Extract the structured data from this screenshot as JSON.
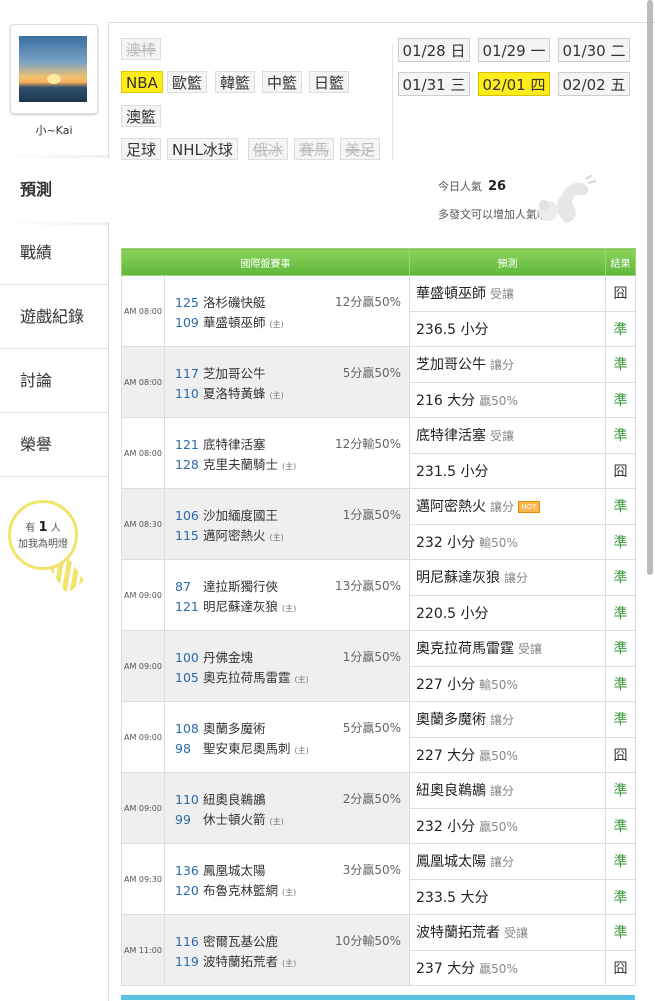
{
  "user": {
    "name": "小~Kai"
  },
  "nav": [
    {
      "label": "預測",
      "active": true
    },
    {
      "label": "戰績"
    },
    {
      "label": "遊戲紀錄"
    },
    {
      "label": "討論"
    },
    {
      "label": "榮譽"
    }
  ],
  "fans": {
    "prefix": "有",
    "count": "1",
    "suffix": "人",
    "line2": "加我為明燈"
  },
  "leagues": {
    "row1": [
      {
        "label": "澳棒",
        "disabled": true
      }
    ],
    "row2": [
      {
        "label": "NBA",
        "active": true
      },
      {
        "label": "歐籃"
      },
      {
        "label": "韓籃"
      },
      {
        "label": "中籃"
      },
      {
        "label": "日籃"
      }
    ],
    "row3": [
      {
        "label": "澳籃"
      }
    ],
    "row4": [
      {
        "label": "足球"
      },
      {
        "label": "NHL冰球"
      },
      {
        "label": "俄冰",
        "disabled": true
      },
      {
        "label": "賽馬",
        "disabled": true
      },
      {
        "label": "美足",
        "disabled": true
      }
    ]
  },
  "dates": [
    {
      "md": "01/28",
      "wd": "日"
    },
    {
      "md": "01/29",
      "wd": "一"
    },
    {
      "md": "01/30",
      "wd": "二"
    },
    {
      "md": "01/31",
      "wd": "三"
    },
    {
      "md": "02/01",
      "wd": "四",
      "active": true
    },
    {
      "md": "02/02",
      "wd": "五"
    }
  ],
  "popularity": {
    "label": "今日人氣",
    "value": "26",
    "hint": "多發文可以增加人氣哦~"
  },
  "table": {
    "headers": [
      "國際盤賽事",
      "預測",
      "結果"
    ],
    "home_mark": "(主)",
    "games": [
      {
        "time": "AM 08:00",
        "away_score": "125",
        "away": "洛杉磯快艇",
        "home_score": "109",
        "home": "華盛頓巫師",
        "spread": "12分贏50%",
        "pick1": "華盛頓巫師",
        "pick1_sub": "受讓",
        "pick2": "236.5 小分",
        "pick2_sub": "",
        "r1": "囧",
        "r2": "準"
      },
      {
        "time": "AM 08:00",
        "away_score": "117",
        "away": "芝加哥公牛",
        "home_score": "110",
        "home": "夏洛特黃蜂",
        "spread": "5分贏50%",
        "pick1": "芝加哥公牛",
        "pick1_sub": "讓分",
        "pick2": "216 大分",
        "pick2_sub": "贏50%",
        "r1": "準",
        "r2": "準"
      },
      {
        "time": "AM 08:00",
        "away_score": "121",
        "away": "底特律活塞",
        "home_score": "128",
        "home": "克里夫蘭騎士",
        "spread": "12分輸50%",
        "pick1": "底特律活塞",
        "pick1_sub": "受讓",
        "pick2": "231.5 小分",
        "pick2_sub": "",
        "r1": "準",
        "r2": "囧"
      },
      {
        "time": "AM 08:30",
        "away_score": "106",
        "away": "沙加緬度國王",
        "home_score": "115",
        "home": "邁阿密熱火",
        "spread": "1分贏50%",
        "pick1": "邁阿密熱火",
        "pick1_sub": "讓分",
        "hot": "HOT",
        "pick2": "232 小分",
        "pick2_sub": "輸50%",
        "r1": "準",
        "r2": "準"
      },
      {
        "time": "AM 09:00",
        "away_score": "87",
        "away": "達拉斯獨行俠",
        "home_score": "121",
        "home": "明尼蘇達灰狼",
        "spread": "13分贏50%",
        "pick1": "明尼蘇達灰狼",
        "pick1_sub": "讓分",
        "pick2": "220.5 小分",
        "pick2_sub": "",
        "r1": "準",
        "r2": "準"
      },
      {
        "time": "AM 09:00",
        "away_score": "100",
        "away": "丹佛金塊",
        "home_score": "105",
        "home": "奧克拉荷馬雷霆",
        "spread": "1分贏50%",
        "pick1": "奧克拉荷馬雷霆",
        "pick1_sub": "受讓",
        "pick2": "227 小分",
        "pick2_sub": "輸50%",
        "r1": "準",
        "r2": "準"
      },
      {
        "time": "AM 09:00",
        "away_score": "108",
        "away": "奧蘭多魔術",
        "home_score": "98",
        "home": "聖安東尼奧馬刺",
        "spread": "5分贏50%",
        "pick1": "奧蘭多魔術",
        "pick1_sub": "讓分",
        "pick2": "227 大分",
        "pick2_sub": "贏50%",
        "r1": "準",
        "r2": "囧"
      },
      {
        "time": "AM 09:00",
        "away_score": "110",
        "away": "紐奧良鵜鶘",
        "home_score": "99",
        "home": "休士頓火箭",
        "spread": "2分贏50%",
        "pick1": "紐奧良鵜鶘",
        "pick1_sub": "讓分",
        "pick2": "232 小分",
        "pick2_sub": "贏50%",
        "r1": "準",
        "r2": "準"
      },
      {
        "time": "AM 09:30",
        "away_score": "136",
        "away": "鳳凰城太陽",
        "home_score": "120",
        "home": "布魯克林籃網",
        "spread": "3分贏50%",
        "pick1": "鳳凰城太陽",
        "pick1_sub": "讓分",
        "pick2": "233.5 大分",
        "pick2_sub": "",
        "r1": "準",
        "r2": "準"
      },
      {
        "time": "AM 11:00",
        "away_score": "116",
        "away": "密爾瓦基公鹿",
        "home_score": "119",
        "home": "波特蘭拓荒者",
        "spread": "10分輸50%",
        "pick1": "波特蘭拓荒者",
        "pick1_sub": "受讓",
        "pick2": "237 大分",
        "pick2_sub": "贏50%",
        "r1": "準",
        "r2": "囧"
      }
    ]
  }
}
